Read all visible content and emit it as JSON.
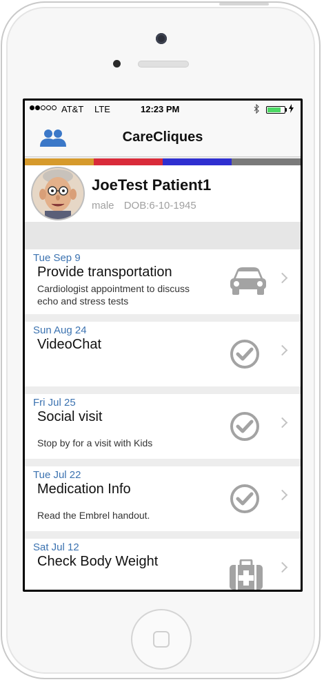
{
  "status_bar": {
    "carrier": "AT&T",
    "network": "LTE",
    "time": "12:23 PM",
    "signal_bars": 2,
    "signal_total": 5,
    "bluetooth_icon": "bluetooth-icon",
    "battery_level": 0.8
  },
  "nav": {
    "title": "CareCliques",
    "left_icon": "people-icon"
  },
  "colors": {
    "accent": "#3b72b0",
    "strip": [
      "#d69a2c",
      "#d92b3a",
      "#2f2fd0",
      "#7a7a7a"
    ]
  },
  "patient": {
    "name": "JoeTest Patient1",
    "gender": "male",
    "dob": "DOB:6-10-1945"
  },
  "tasks": [
    {
      "date": "Tue Sep 9",
      "title": "Provide transportation",
      "description": "Cardiologist appointment to discuss echo and stress tests",
      "icon": "car-icon"
    },
    {
      "date": "Sun Aug 24",
      "title": "VideoChat",
      "description": "",
      "icon": "check-circle-icon"
    },
    {
      "date": "Fri Jul 25",
      "title": "Social visit",
      "description": "Stop by for a visit with Kids",
      "icon": "check-circle-icon"
    },
    {
      "date": "Tue Jul 22",
      "title": "Medication Info",
      "description": "Read the Embrel handout.",
      "icon": "check-circle-icon"
    },
    {
      "date": "Sat Jul 12",
      "title": "Check Body Weight",
      "description": "",
      "icon": "medical-kit-icon"
    }
  ]
}
